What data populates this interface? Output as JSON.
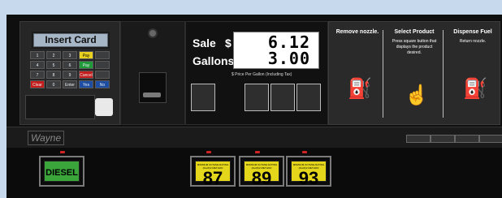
{
  "leftpanel": {
    "card_text": "Insert Card",
    "keys": [
      "1",
      "2",
      "3",
      "Pay\nCash",
      "",
      "4",
      "5",
      "6",
      "Pay\nCredit",
      "",
      "7",
      "8",
      "9",
      "Cancel",
      "",
      "Clear",
      "0",
      "Enter",
      "Yes",
      "No"
    ]
  },
  "sale": {
    "sale_label": "Sale",
    "currency": "$",
    "sale_value": "6.12",
    "gallons_label": "Gallons",
    "gallons_value": "3.00",
    "price_caption": "$ Price Per Gallon (Including Tax)"
  },
  "instructions": {
    "remove_title": "Remove\nnozzle.",
    "select_title": "Select\nProduct",
    "select_text": "Press square button\nthat displays the\nproduct desired.",
    "dispense_title": "Dispense\nFuel",
    "dispense_text": "Return nozzle."
  },
  "brand": "Wayne",
  "grades": {
    "diesel": "DIESEL",
    "g87": "87",
    "g89": "89",
    "g93": "93",
    "grade_caption": "MINIMUM OCTANE RATING\n(R+M)/2 METHOD"
  }
}
